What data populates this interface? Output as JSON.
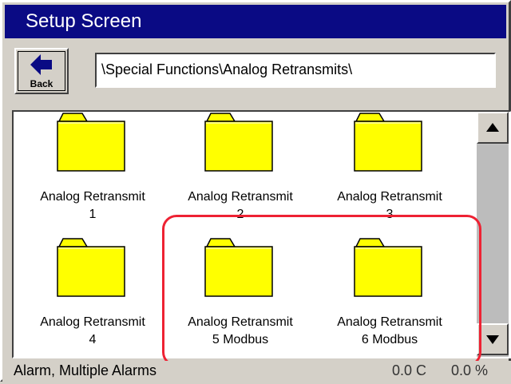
{
  "window": {
    "title": "Setup Screen"
  },
  "toolbar": {
    "back_label": "Back",
    "path": "\\Special Functions\\Analog Retransmits\\"
  },
  "folders": [
    {
      "line1": "Analog Retransmit",
      "line2": "1"
    },
    {
      "line1": "Analog Retransmit",
      "line2": "2"
    },
    {
      "line1": "Analog Retransmit",
      "line2": "3"
    },
    {
      "line1": "Analog Retransmit",
      "line2": "4"
    },
    {
      "line1": "Analog Retransmit",
      "line2": "5 Modbus"
    },
    {
      "line1": "Analog Retransmit",
      "line2": "6 Modbus"
    }
  ],
  "status": {
    "alarm_text": "Alarm, Multiple Alarms",
    "temperature": "0.0 C",
    "percent": "0.0 %"
  },
  "colors": {
    "title_bar": "#0a0a84",
    "folder_fill": "#ffff00",
    "highlight": "#ee2233"
  },
  "icons": {
    "back": "left-arrow-icon",
    "folder": "folder-icon",
    "scroll_up": "scroll-up-arrow-icon",
    "scroll_down": "scroll-down-arrow-icon"
  }
}
